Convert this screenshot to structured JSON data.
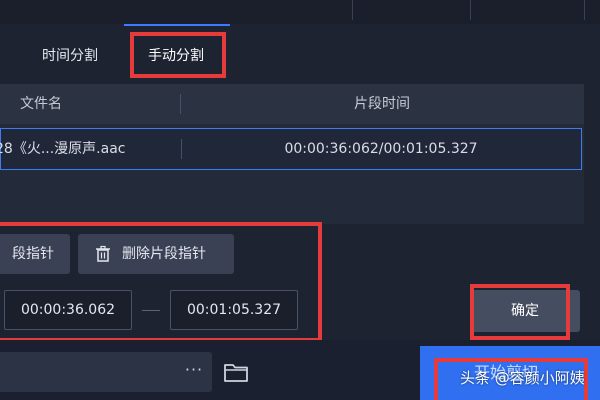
{
  "tabs": {
    "time_split": "时间分割",
    "manual_split": "手动分割"
  },
  "table": {
    "headers": {
      "file_name": "文件名",
      "segment_time": "片段时间"
    },
    "rows": [
      {
        "file_name": "28《火...漫原声.aac",
        "segment_time": "00:00:36:062/00:01:05.327"
      }
    ]
  },
  "toolbar": {
    "add_pointer_label": "段指针",
    "delete_pointer_label": "删除片段指针"
  },
  "times": {
    "start": "00:00:36.062",
    "end": "00:01:05.327"
  },
  "actions": {
    "confirm_label": "确定",
    "start_cut_label": "开始剪切",
    "more_label": "···"
  },
  "watermark": "头条 @容颜小阿姨",
  "icons": {
    "delete": "trash-icon",
    "folder": "folder-icon"
  },
  "colors": {
    "accent": "#3b7bff",
    "highlight_box": "#e53b3b",
    "start_button": "#2f6ff0"
  }
}
